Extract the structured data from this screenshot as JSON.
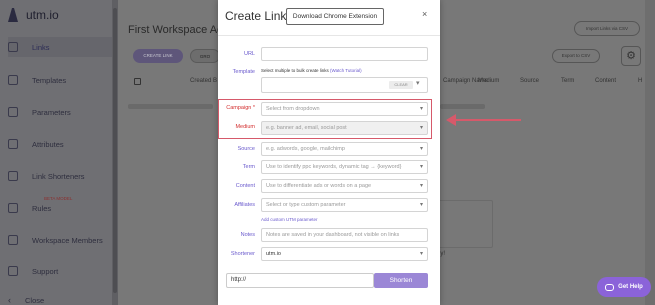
{
  "app": {
    "logo_text": "utm.io",
    "sidebar": [
      {
        "label": "Links",
        "icon": "link-icon",
        "active": true
      },
      {
        "label": "Templates",
        "icon": "template-icon"
      },
      {
        "label": "Parameters",
        "icon": "parameters-icon"
      },
      {
        "label": "Attributes",
        "icon": "attributes-icon"
      },
      {
        "label": "Link Shorteners",
        "icon": "shortener-icon"
      },
      {
        "label": "Rules",
        "icon": "rules-icon",
        "badge": "BETA MODEL"
      },
      {
        "label": "Workspace Members",
        "icon": "members-icon"
      },
      {
        "label": "Support",
        "icon": "support-icon"
      },
      {
        "label": "Close",
        "icon": "chevron-left-icon"
      }
    ],
    "main": {
      "title": "First Workspace Acti",
      "create_link": "CREATE LINK",
      "group_btn": "GRO",
      "import": "Import Links via CSV",
      "export": "Export to CSV",
      "columns": [
        "Created B",
        "Campaign Name",
        "Medium",
        "Source",
        "Term",
        "Content",
        "H"
      ],
      "empty_text": "ey!"
    },
    "help": "Get Help"
  },
  "modal": {
    "title": "Create Link",
    "download": "Download Chrome Extension",
    "close": "×",
    "url_label": "URL",
    "template_label": "Template",
    "template_hint": "Select multiple to bulk create links",
    "template_hint_link": "(Watch Tutorial)",
    "clear": "CLEAR",
    "fields": [
      {
        "label": "Campaign *",
        "placeholder": "Select from dropdown",
        "required": true,
        "select": true
      },
      {
        "label": "Medium",
        "placeholder": "e.g. banner ad, email, social post",
        "required": true,
        "select": true,
        "disabled": true
      },
      {
        "label": "Source",
        "placeholder": "e.g. adwords, google, mailchimp",
        "select": true
      },
      {
        "label": "Term",
        "placeholder": "Use to identify ppc keywords, dynamic tag → {keyword}",
        "select": true
      },
      {
        "label": "Content",
        "placeholder": "Use to differentiate ads or words on a page",
        "select": true
      },
      {
        "label": "Affiliates",
        "placeholder": "Select or type custom parameter",
        "select": true
      }
    ],
    "custom_param_link": "Add custom UTM parameter",
    "notes_label": "Notes",
    "notes_placeholder": "Notes are saved in your dashboard, not visible on links",
    "shortener_label": "Shortener",
    "shortener_value": "utm.io",
    "url_output": "http://",
    "shorten_btn": "Shorten"
  },
  "colors": {
    "accent": "#6a5acd",
    "required": "#d32f2f",
    "highlight": "#d6596a",
    "help": "#8b63d9"
  }
}
